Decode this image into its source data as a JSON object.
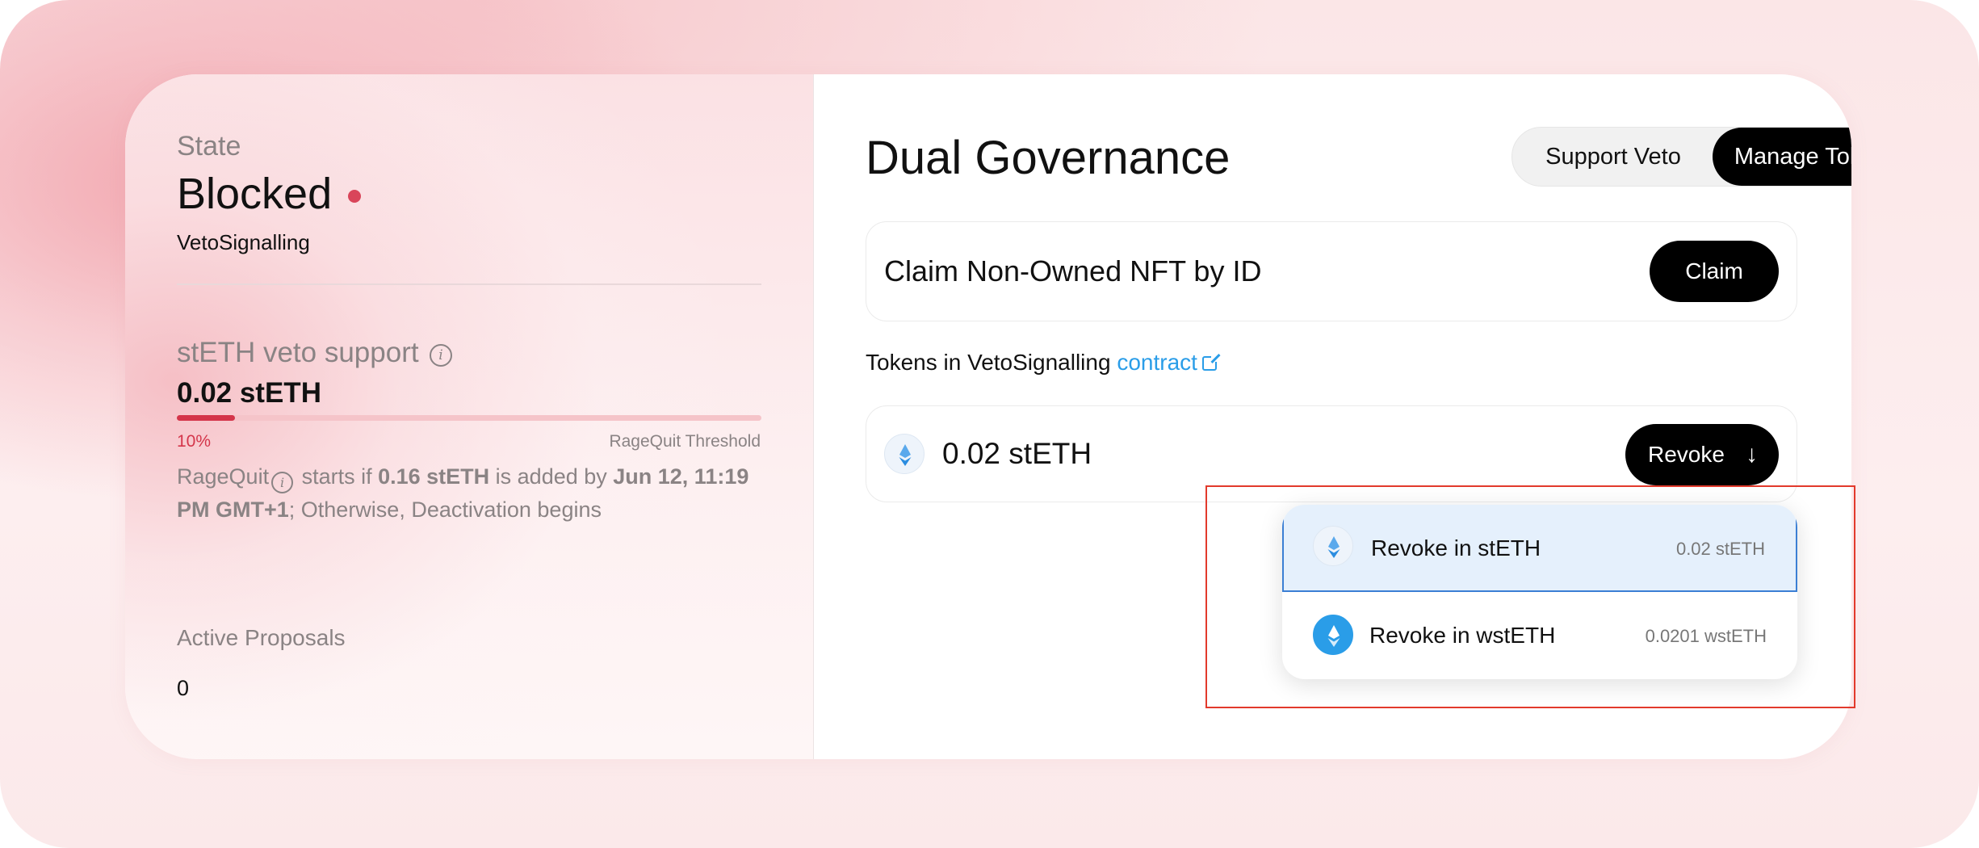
{
  "state": {
    "label": "State",
    "value": "Blocked",
    "sub": "VetoSignalling",
    "dot_color": "#d9455a"
  },
  "veto": {
    "label": "stETH veto support",
    "value": "0.02 stETH",
    "progress_percent": 10,
    "progress_label": "10%",
    "threshold_label": "RageQuit Threshold",
    "rq_prefix": "RageQuit",
    "rq_mid1": " starts if ",
    "rq_amount": "0.16 stETH",
    "rq_mid2": " is added by ",
    "rq_date": "Jun 12, 11:19 PM GMT+1",
    "rq_suffix": "; Otherwise, Deactivation begins"
  },
  "proposals": {
    "label": "Active Proposals",
    "value": "0"
  },
  "main": {
    "title": "Dual Governance",
    "tabs": [
      {
        "label": "Support Veto",
        "active": false
      },
      {
        "label": "Manage Tokens",
        "active": true
      }
    ],
    "claim": {
      "text": "Claim Non-Owned NFT by ID",
      "button": "Claim"
    },
    "tokens": {
      "label": "Tokens in VetoSignalling ",
      "link": "contract",
      "amount": "0.02 stETH",
      "revoke_button": "Revoke",
      "revoke_arrow": "↓"
    },
    "dropdown": [
      {
        "label": "Revoke in stETH",
        "amount": "0.02 stETH",
        "icon": "steth-icon",
        "selected": true
      },
      {
        "label": "Revoke in wstETH",
        "amount": "0.0201 wstETH",
        "icon": "wsteth-icon",
        "selected": false
      }
    ]
  },
  "colors": {
    "accent_red": "#d4354a",
    "link_blue": "#2a9de8",
    "highlight": "#e23a2c",
    "selected_bg": "#e5f0fc"
  }
}
